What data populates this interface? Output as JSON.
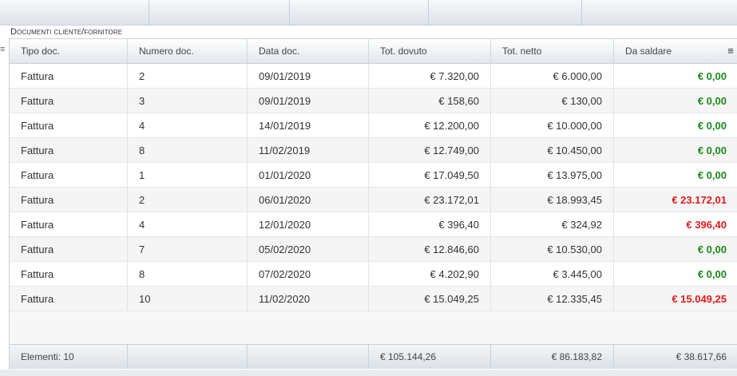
{
  "section_title": "Documenti cliente/fornitore",
  "columns": [
    "Tipo doc.",
    "Numero doc.",
    "Data doc.",
    "Tot. dovuto",
    "Tot. netto",
    "Da saldare"
  ],
  "rows": [
    {
      "tipo": "Fattura",
      "numero": "2",
      "data": "09/01/2019",
      "dovuto": "€ 7.320,00",
      "netto": "€ 6.000,00",
      "saldare": "€ 0,00",
      "status": "green"
    },
    {
      "tipo": "Fattura",
      "numero": "3",
      "data": "09/01/2019",
      "dovuto": "€ 158,60",
      "netto": "€ 130,00",
      "saldare": "€ 0,00",
      "status": "green"
    },
    {
      "tipo": "Fattura",
      "numero": "4",
      "data": "14/01/2019",
      "dovuto": "€ 12.200,00",
      "netto": "€ 10.000,00",
      "saldare": "€ 0,00",
      "status": "green"
    },
    {
      "tipo": "Fattura",
      "numero": "8",
      "data": "11/02/2019",
      "dovuto": "€ 12.749,00",
      "netto": "€ 10.450,00",
      "saldare": "€ 0,00",
      "status": "green"
    },
    {
      "tipo": "Fattura",
      "numero": "1",
      "data": "01/01/2020",
      "dovuto": "€ 17.049,50",
      "netto": "€ 13.975,00",
      "saldare": "€ 0,00",
      "status": "green"
    },
    {
      "tipo": "Fattura",
      "numero": "2",
      "data": "06/01/2020",
      "dovuto": "€ 23.172,01",
      "netto": "€ 18.993,45",
      "saldare": "€ 23.172,01",
      "status": "red"
    },
    {
      "tipo": "Fattura",
      "numero": "4",
      "data": "12/01/2020",
      "dovuto": "€ 396,40",
      "netto": "€ 324,92",
      "saldare": "€ 396,40",
      "status": "red"
    },
    {
      "tipo": "Fattura",
      "numero": "7",
      "data": "05/02/2020",
      "dovuto": "€ 12.846,60",
      "netto": "€ 10.530,00",
      "saldare": "€ 0,00",
      "status": "green"
    },
    {
      "tipo": "Fattura",
      "numero": "8",
      "data": "07/02/2020",
      "dovuto": "€ 4.202,90",
      "netto": "€ 3.445,00",
      "saldare": "€ 0,00",
      "status": "green"
    },
    {
      "tipo": "Fattura",
      "numero": "10",
      "data": "11/02/2020",
      "dovuto": "€ 15.049,25",
      "netto": "€ 12.335,45",
      "saldare": "€ 15.049,25",
      "status": "red"
    }
  ],
  "footer": {
    "count": "Elementi: 10",
    "tot_dovuto": "€ 105.144,26",
    "tot_netto": "€ 86.183,82",
    "da_saldare": "€ 38.617,66"
  },
  "icons": {
    "column_menu": "hamburger-menu-icon",
    "row_handle": "drag-handle-icon"
  },
  "colors": {
    "paid": "#1b8a1b",
    "unpaid": "#e21b1b",
    "header": "#e2e7ec"
  }
}
